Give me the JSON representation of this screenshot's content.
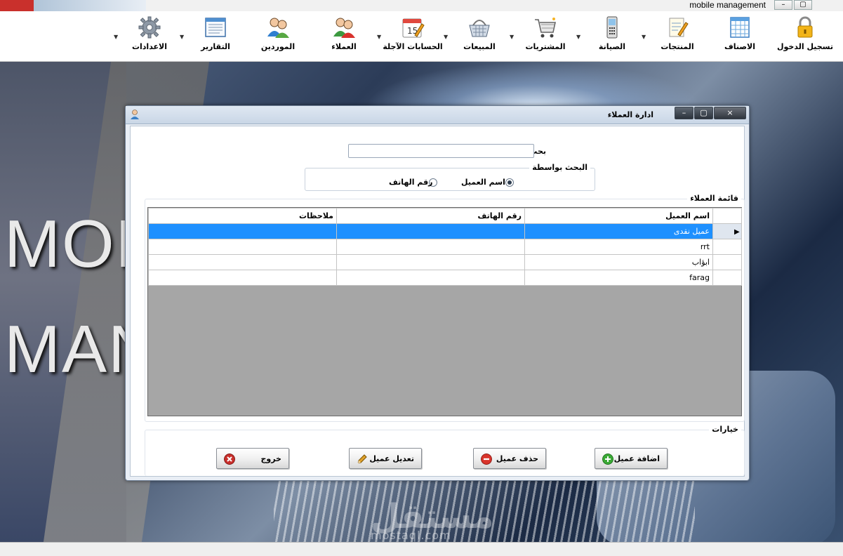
{
  "app": {
    "title": "mobile management",
    "window_controls": [
      "–",
      "▢",
      "×"
    ]
  },
  "toolbar": {
    "items": [
      {
        "label": "تسجيل الدخول",
        "icon": "lock-icon",
        "dropdown": false
      },
      {
        "label": "الاصناف",
        "icon": "grid-sheet-icon",
        "dropdown": false
      },
      {
        "label": "المنتجات",
        "icon": "notepad-pencil-icon",
        "dropdown": true
      },
      {
        "label": "الصيانة",
        "icon": "mobile-phone-icon",
        "dropdown": true
      },
      {
        "label": "المشتريات",
        "icon": "shopping-cart-icon",
        "dropdown": true
      },
      {
        "label": "المبيعات",
        "icon": "basket-icon",
        "dropdown": true
      },
      {
        "label": "الحسابات الآجلة",
        "icon": "calendar-icon",
        "dropdown": true,
        "calendar_day": "15"
      },
      {
        "label": "العملاء",
        "icon": "customers-icon",
        "dropdown": false
      },
      {
        "label": "الموردين",
        "icon": "suppliers-icon",
        "dropdown": false
      },
      {
        "label": "التقارير",
        "icon": "report-window-icon",
        "dropdown": true
      },
      {
        "label": "الاعدادات",
        "icon": "gear-icon",
        "dropdown": true
      }
    ]
  },
  "background": {
    "line1": "MOBI",
    "line2": "MAN",
    "watermark_ar": "مستقل",
    "watermark_en": "mostaql.com"
  },
  "dialog": {
    "title": "ادارة العملاء",
    "controls": [
      "–",
      "▢",
      "×"
    ],
    "search": {
      "label": "بحث",
      "value": "",
      "placeholder": ""
    },
    "search_by": {
      "legend": "البحث بواسطة",
      "options": [
        {
          "label": "اسم العميل",
          "selected": true
        },
        {
          "label": "رقم الهاتف",
          "selected": false
        }
      ]
    },
    "customers": {
      "legend": "قائمة العملاء",
      "columns": [
        "اسم العميل",
        "رقم الهاتف",
        "ملاحظات"
      ],
      "rows": [
        {
          "name": "عميل نقدى",
          "phone": "",
          "notes": "",
          "selected": true
        },
        {
          "name": "rrt",
          "phone": "",
          "notes": "",
          "selected": false
        },
        {
          "name": "ابؤاب",
          "phone": "",
          "notes": "",
          "selected": false
        },
        {
          "name": "farag",
          "phone": "",
          "notes": "",
          "selected": false
        }
      ]
    },
    "options": {
      "legend": "خيارات",
      "buttons": [
        {
          "label": "اضافة عميل",
          "icon": "add-icon",
          "color": "#3aa935"
        },
        {
          "label": "حذف عميل",
          "icon": "remove-icon",
          "color": "#d9342b"
        },
        {
          "label": "تعديل عميل",
          "icon": "pencil-icon",
          "color": "#e1a22c"
        },
        {
          "label": "خروج",
          "icon": "close-circle-icon",
          "color": "#c9302c"
        }
      ]
    }
  },
  "colors": {
    "selection": "#1e90ff",
    "dialog_bg": "#e9eef5"
  }
}
